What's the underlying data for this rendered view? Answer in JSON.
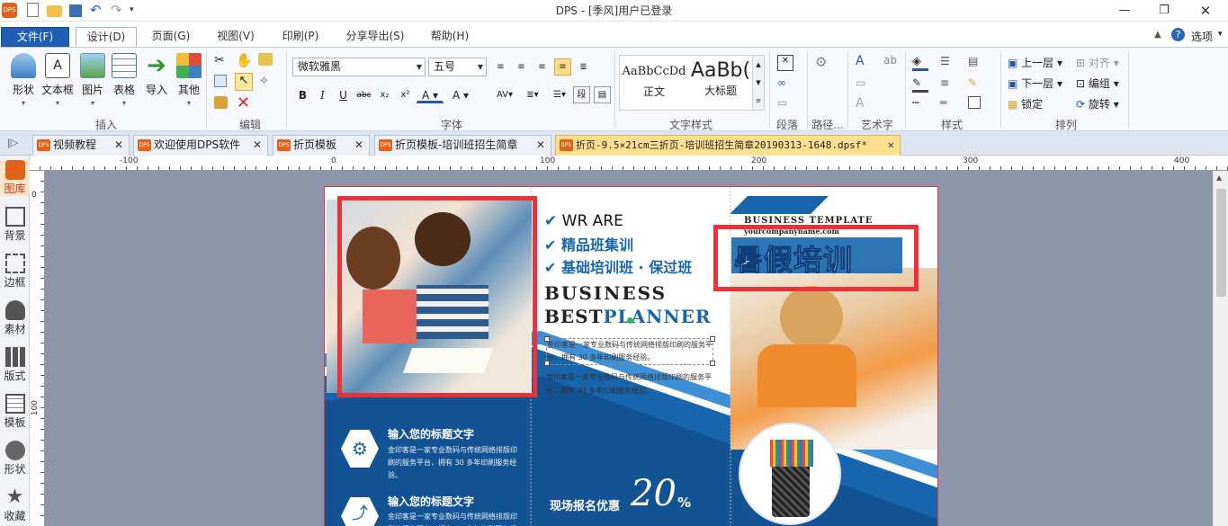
{
  "window": {
    "title": "DPS - [季风]用户已登录"
  },
  "menu": {
    "tabs": [
      "文件(F)",
      "设计(D)",
      "页面(G)",
      "视图(V)",
      "印刷(P)",
      "分享导出(S)",
      "帮助(H)"
    ],
    "options": "选项"
  },
  "ribbon": {
    "insert": {
      "label": "插入",
      "buttons": [
        "形状",
        "文本框",
        "图片",
        "表格",
        "导入",
        "其他"
      ]
    },
    "edit": {
      "label": "编辑"
    },
    "font": {
      "label": "字体",
      "family": "微软雅黑",
      "size": "五号"
    },
    "textstyle": {
      "label": "文字样式",
      "styles": [
        {
          "sample": "AaBbCcDd",
          "name": "正文"
        },
        {
          "sample": "AaBb(",
          "name": "大标题"
        }
      ]
    },
    "paragraph": {
      "label": "段落"
    },
    "path": {
      "label": "路径..."
    },
    "art": {
      "label": "艺术字"
    },
    "style": {
      "label": "样式"
    },
    "arrange": {
      "label": "排列",
      "items": [
        "上一层",
        "对齐",
        "下一层",
        "编组",
        "锁定",
        "旋转"
      ]
    }
  },
  "doc_tabs": [
    {
      "title": "视频教程",
      "active": false
    },
    {
      "title": "欢迎使用DPS软件",
      "active": false
    },
    {
      "title": "折页模板",
      "active": false
    },
    {
      "title": "折页模板-培训班招生简章",
      "active": false
    },
    {
      "title": "折页-9.5×21cm三折页-培训班招生简章20190313-1648.dpsf*",
      "active": true
    }
  ],
  "sidebar": [
    "图库",
    "背景",
    "边框",
    "素材",
    "版式",
    "模板",
    "形状",
    "收藏"
  ],
  "ruler": {
    "top": [
      "-100",
      "0",
      "100",
      "200",
      "300",
      "400"
    ],
    "left": [
      "0",
      "100"
    ]
  },
  "brochure": {
    "checks": [
      "WR ARE",
      "精品班集训",
      "基础培训班 · 保过班"
    ],
    "business": "BUSINESS",
    "best": "BEST",
    "planner": "PLANNER",
    "para1": "金印客是一家专业数码与传统网络排版印刷的服务平台，拥有 30 多年印刷服务经验。",
    "para2": "金印客是一家专业数码与传统网络排版印刷的服务平台，拥有 30 多年印刷服务经验。",
    "item1_title": "输入您的标题文字",
    "item1_body": "金印客是一家专业数码与传统网络排版印刷的服务平台，拥有 30 多年印刷服务经验。",
    "item2_title": "输入您的标题文字",
    "item2_body": "金印客是一家专业数码与传统网络排版印刷的服务平台，拥有 30 多年印刷服务经验。",
    "promo": "现场报名优惠",
    "promo_number": "20",
    "promo_unit": "%",
    "business_template": "BUSINESS TEMPLATE",
    "company": "yourcompanyname.com",
    "headline": "暑假培训"
  },
  "colors": {
    "accent": "#1e5fb4",
    "brochure_blue": "#1766ad",
    "dark_blue": "#0f3f7a",
    "highlight": "#e8333a"
  }
}
